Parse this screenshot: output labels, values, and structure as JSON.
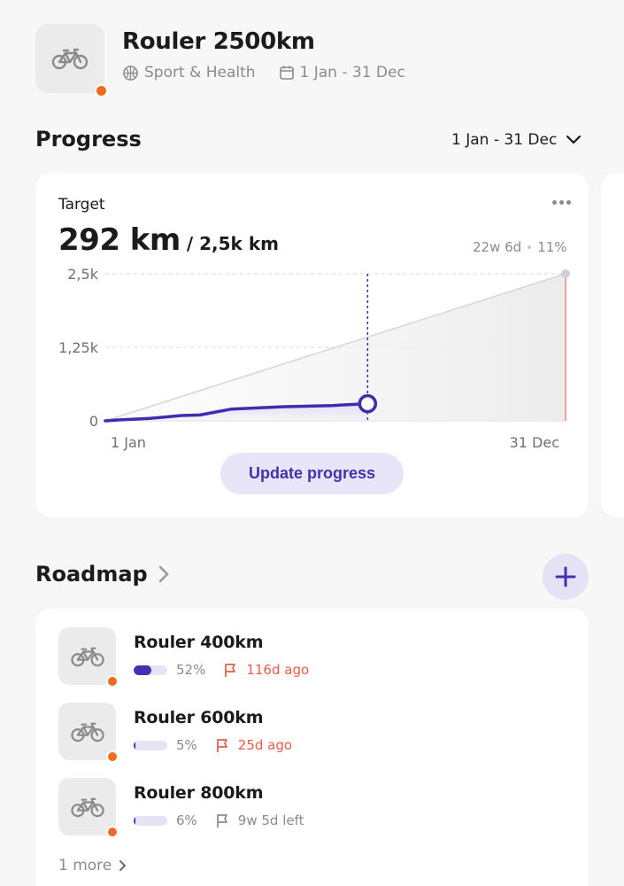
{
  "header": {
    "title": "Rouler 2500km",
    "category": "Sport & Health",
    "date_range": "1 Jan - 31 Dec"
  },
  "progress": {
    "heading": "Progress",
    "range_selector": "1 Jan - 31 Dec",
    "card": {
      "label": "Target",
      "current_value": "292 km",
      "target_value": "/ 2,5k km",
      "time_left": "22w 6d",
      "percent": "11%",
      "update_button": "Update progress"
    }
  },
  "chart_data": {
    "type": "line",
    "x_tick_labels": [
      "1 Jan",
      "31 Dec"
    ],
    "y_tick_labels": [
      "2,5k",
      "1,25k",
      "0"
    ],
    "ylim": [
      0,
      2500
    ],
    "xlim_days": [
      0,
      365
    ],
    "grid": true,
    "series": [
      {
        "x_days": [
          0,
          10,
          35,
          50,
          60,
          75,
          100,
          140,
          180,
          208
        ],
        "values": [
          0,
          15,
          40,
          70,
          90,
          100,
          200,
          240,
          260,
          292
        ],
        "color": "#3d2db0"
      },
      {
        "x_days": [
          0,
          365
        ],
        "values": [
          0,
          2500
        ],
        "color": "#d6d6d6"
      }
    ],
    "today_day": 208,
    "colors": {
      "progress": "#3d2db0",
      "target_line": "#d6d6d6",
      "end_marker": "#f08a76"
    }
  },
  "roadmap": {
    "heading": "Roadmap",
    "items": [
      {
        "title": "Rouler 400km",
        "percent": "52%",
        "progress": 0.52,
        "status": "116d ago",
        "overdue": true
      },
      {
        "title": "Rouler 600km",
        "percent": "5%",
        "progress": 0.05,
        "status": "25d ago",
        "overdue": true
      },
      {
        "title": "Rouler 800km",
        "percent": "6%",
        "progress": 0.06,
        "status": "9w 5d left",
        "overdue": false
      }
    ],
    "more": "1 more"
  },
  "colors": {
    "accent": "#4231b0",
    "orange_dot": "#f26a1b",
    "overdue": "#ea5c45",
    "muted": "#8a8a8f"
  }
}
